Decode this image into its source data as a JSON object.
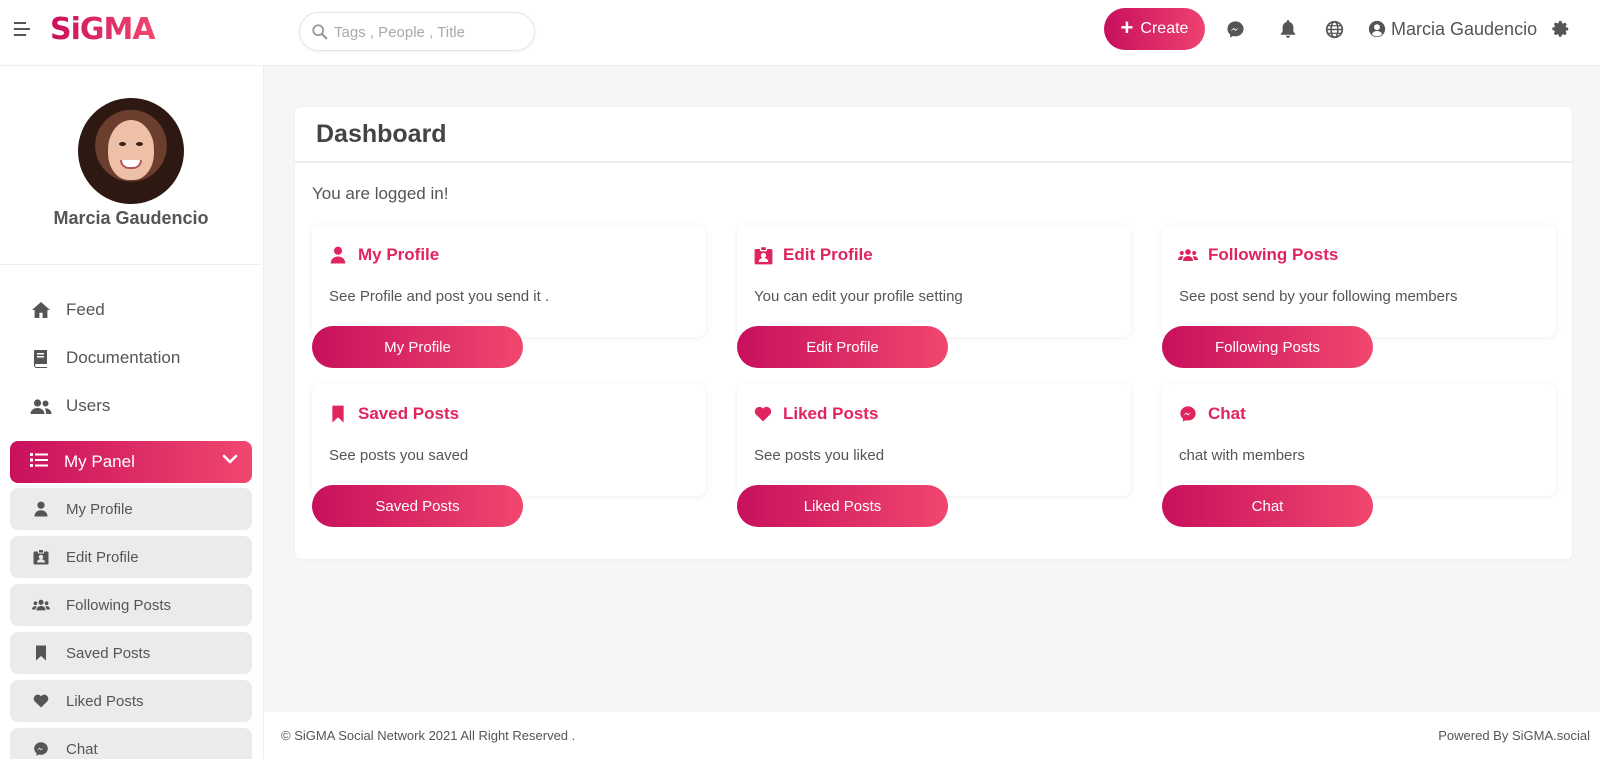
{
  "header": {
    "logo": "SiGMA",
    "search_placeholder": "Tags , People , Title",
    "create_label": "Create",
    "user_name": "Marcia Gaudencio"
  },
  "sidebar": {
    "user_name": "Marcia Gaudencio",
    "items": [
      {
        "label": "Feed",
        "icon": "home-icon"
      },
      {
        "label": "Documentation",
        "icon": "book-icon"
      },
      {
        "label": "Users",
        "icon": "users-icon"
      }
    ],
    "panel_label": "My Panel",
    "panel_items": [
      {
        "label": "My Profile",
        "icon": "user-icon"
      },
      {
        "label": "Edit Profile",
        "icon": "id-badge-icon"
      },
      {
        "label": "Following Posts",
        "icon": "users-group-icon"
      },
      {
        "label": "Saved Posts",
        "icon": "bookmark-icon"
      },
      {
        "label": "Liked Posts",
        "icon": "heart-icon"
      },
      {
        "label": "Chat",
        "icon": "messenger-icon"
      }
    ]
  },
  "main": {
    "title": "Dashboard",
    "status": "You are logged in!",
    "tiles": [
      {
        "title": "My Profile",
        "desc": "See Profile and post you send it .",
        "button": "My Profile",
        "icon": "user-icon"
      },
      {
        "title": "Edit Profile",
        "desc": "You can edit your profile setting",
        "button": "Edit Profile",
        "icon": "id-badge-icon"
      },
      {
        "title": "Following Posts",
        "desc": "See post send by your following members",
        "button": "Following Posts",
        "icon": "users-group-icon"
      },
      {
        "title": "Saved Posts",
        "desc": "See posts you saved",
        "button": "Saved Posts",
        "icon": "bookmark-icon"
      },
      {
        "title": "Liked Posts",
        "desc": "See posts you liked",
        "button": "Liked Posts",
        "icon": "heart-icon"
      },
      {
        "title": "Chat",
        "desc": "chat with members",
        "button": "Chat",
        "icon": "messenger-icon"
      }
    ]
  },
  "footer": {
    "copyright": "© SiGMA Social Network 2021 All Right Reserved .",
    "powered": "Powered By SiGMA.social"
  },
  "colors": {
    "accent_start": "#c8105d",
    "accent_end": "#f0476e",
    "title_pink": "#e0245e"
  }
}
